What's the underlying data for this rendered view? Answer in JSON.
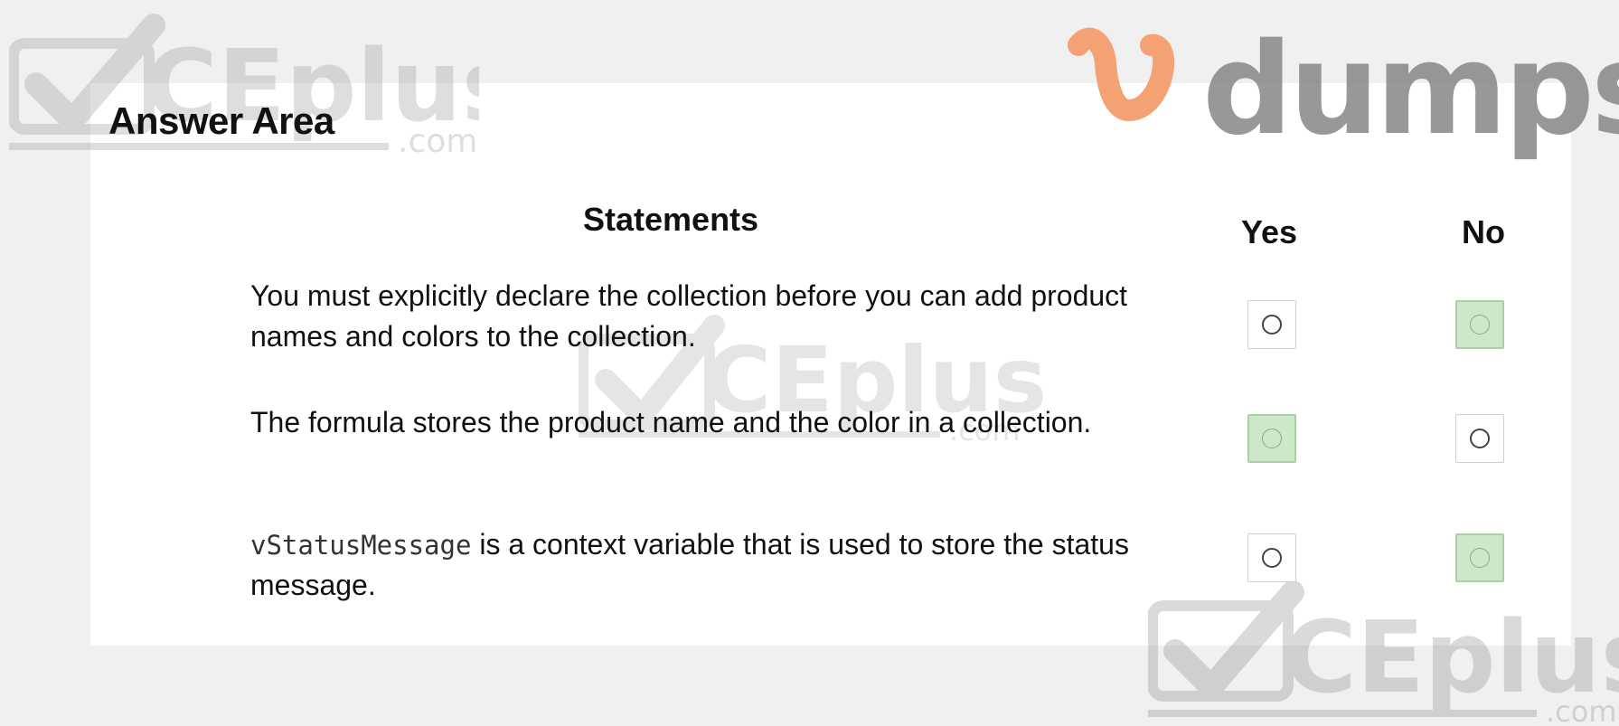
{
  "answer_area": {
    "title": "Answer Area"
  },
  "table": {
    "headers": {
      "statements": "Statements",
      "yes": "Yes",
      "no": "No"
    },
    "rows": [
      {
        "statement": "You must explicitly declare the collection before you can add product names and colors to the collection.",
        "code": "",
        "selected": "No"
      },
      {
        "statement": "The formula stores the product name and the color in a collection.",
        "code": "",
        "selected": "Yes"
      },
      {
        "statement": " is a context variable that is used to store the status message.",
        "code": "vStatusMessage",
        "selected": "No"
      }
    ]
  },
  "watermarks": {
    "vdumps_brand": "dumps",
    "ceplus_text": "CEplus",
    "ceplus_suffix": ".com"
  },
  "colors": {
    "selected_fill": "#cde8c9",
    "vdumps_orange": "#f4a274",
    "watermark_gray": "#8d8d8d"
  },
  "icons": {
    "watermark_check": "checkmark-icon",
    "vdumps_mark": "v-logo-icon"
  }
}
